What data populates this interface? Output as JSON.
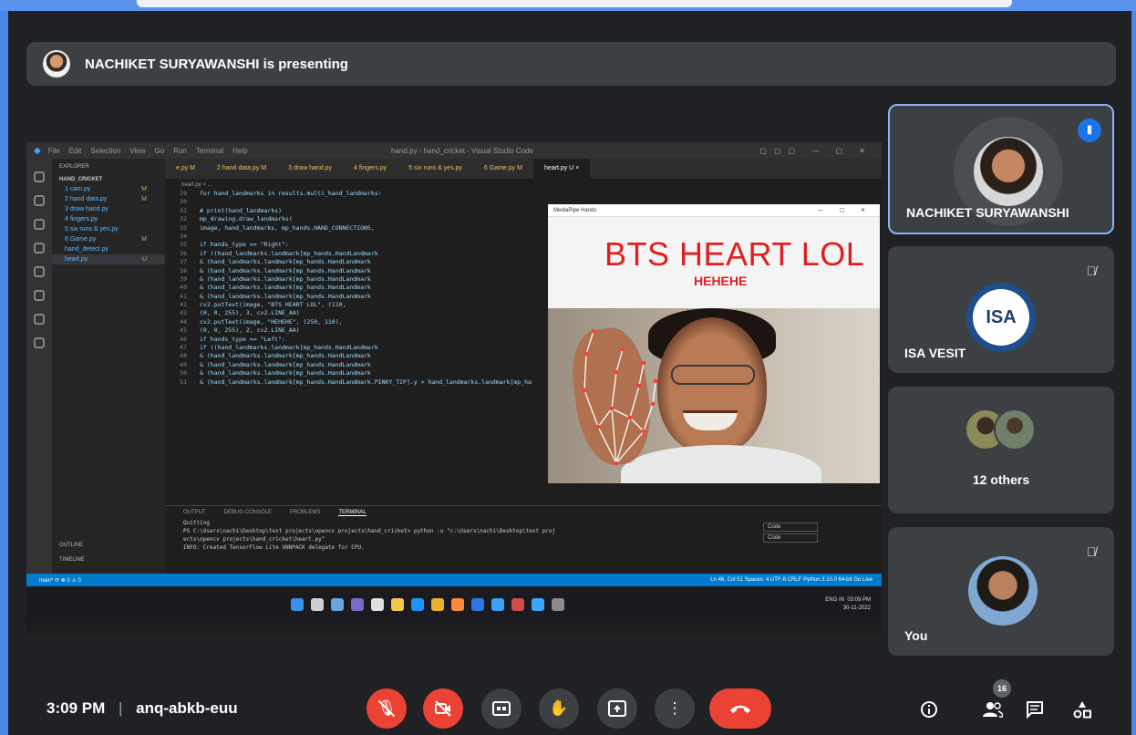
{
  "presenting_banner": "NACHIKET SURYAWANSHI is presenting",
  "shared_screen": {
    "window_title": "hand.py - hand_cricket - Visual Studio Code",
    "menu": [
      "File",
      "Edit",
      "Selection",
      "View",
      "Go",
      "Run",
      "Terminal",
      "Help"
    ],
    "explorer_header": "EXPLORER",
    "project": "HAND_CRICKET",
    "files": [
      {
        "name": "1 cam.py",
        "status": "M"
      },
      {
        "name": "2 hand data.py",
        "status": "M"
      },
      {
        "name": "3 draw hand.py",
        "status": ""
      },
      {
        "name": "4 fingers.py",
        "status": ""
      },
      {
        "name": "5 six runs & yes.py",
        "status": ""
      },
      {
        "name": "6 Game.py",
        "status": "M"
      },
      {
        "name": "hand_detect.py",
        "status": ""
      },
      {
        "name": "heart.py",
        "status": "U"
      }
    ],
    "outline": "OUTLINE",
    "timeline": "TIMELINE",
    "tabs": [
      "e.py M",
      "2 hand data.py M",
      "3 draw hand.py",
      "4 fingers.py",
      "5 six runs & yes.py",
      "6 Game.py M",
      "heart.py U ×"
    ],
    "breadcrumb": "heart.py > ...",
    "code_lines": [
      {
        "no": "29",
        "text": "            for hand_landmarks in results.multi_hand_landmarks:"
      },
      {
        "no": "30",
        "text": ""
      },
      {
        "no": "31",
        "text": "                # print(hand_landmarks)"
      },
      {
        "no": "32",
        "text": "                mp_drawing.draw_landmarks("
      },
      {
        "no": "33",
        "text": "                    image, hand_landmarks, mp_hands.HAND_CONNECTIONS,"
      },
      {
        "no": "34",
        "text": ""
      },
      {
        "no": "35",
        "text": "                if hands_type == \"Right\":"
      },
      {
        "no": "36",
        "text": "                    if ((hand_landmarks.landmark[mp_hands.HandLandmark"
      },
      {
        "no": "37",
        "text": "                        & (hand_landmarks.landmark[mp_hands.HandLandmark"
      },
      {
        "no": "38",
        "text": "                        & (hand_landmarks.landmark[mp_hands.HandLandmark"
      },
      {
        "no": "39",
        "text": "                        & (hand_landmarks.landmark[mp_hands.HandLandmark"
      },
      {
        "no": "40",
        "text": "                        & (hand_landmarks.landmark[mp_hands.HandLandmark"
      },
      {
        "no": "41",
        "text": "                            & (hand_landmarks.landmark[mp_hands.HandLandmark"
      },
      {
        "no": "42",
        "text": "                        cv2.putText(image, \"BTS HEART LOL\", (110,"
      },
      {
        "no": "43",
        "text": "                                    (0, 0, 255), 3, cv2.LINE_AA)"
      },
      {
        "no": "44",
        "text": "                        cv2.putText(image, \"HEHEHE\", (250, 110),"
      },
      {
        "no": "45",
        "text": "                                    (0, 0, 255), 2, cv2.LINE_AA)"
      },
      {
        "no": "46",
        "text": "                if hands_type == \"Left\":"
      },
      {
        "no": "47",
        "text": "                    if ((hand_landmarks.landmark[mp_hands.HandLandmark"
      },
      {
        "no": "48",
        "text": "                        & (hand_landmarks.landmark[mp_hands.HandLandmark"
      },
      {
        "no": "49",
        "text": "                        & (hand_landmarks.landmark[mp_hands.HandLandmark"
      },
      {
        "no": "50",
        "text": "                        & (hand_landmarks.landmark[mp_hands.HandLandmark"
      },
      {
        "no": "51",
        "text": "                        & (hand_landmarks.landmark[mp_hands.HandLandmark.PINKY_TIP].y > hand_landmarks.landmark[mp_ha"
      }
    ],
    "terminal_tabs": [
      "OUTPUT",
      "DEBUG CONSOLE",
      "PROBLEMS",
      "TERMINAL"
    ],
    "terminal_lines": [
      "Quitting",
      "PS C:\\Users\\nachi\\Desktop\\text projects\\opencv projects\\hand_cricket> python -u \"c:\\Users\\nachi\\Desktop\\text proj",
      "ects\\opencv projects\\hand_cricket\\heart.py\"",
      "INFO: Created TensorFlow Lite XNNPACK delegate for CPU."
    ],
    "terminal_side": [
      "Code",
      "Code"
    ],
    "status_left": "main*  ⟳  ⊗ 0 ⚠ 0",
    "status_right": "Ln 46, Col 51   Spaces: 4   UTF-8   CRLF   Python   3.10.0 64-bit   Go Live",
    "camera_window_title": "MediaPipe Hands",
    "overlay_text_1": "BTS HEART LOL",
    "overlay_text_2": "HEHEHE",
    "tray_time": "03:09 PM",
    "tray_date": "30-11-2022",
    "tray_lang": "ENG IN"
  },
  "tiles": [
    {
      "name": "NACHIKET SURYAWANSHI",
      "state": "speaking"
    },
    {
      "name": "ISA VESIT",
      "logo_text": "ISA",
      "state": "muted"
    },
    {
      "name": "12 others"
    },
    {
      "name": "You",
      "state": "muted"
    }
  ],
  "bottom_bar": {
    "time": "3:09 PM",
    "separator": "|",
    "meeting_code": "anq-abkb-euu",
    "participant_count": "16"
  },
  "colors": {
    "meet_bg": "#202124",
    "tile_bg": "#3c4043",
    "accent_red": "#ea4335",
    "speaking_blue": "#8ab4f8",
    "overlay_red": "#e01e1e"
  }
}
